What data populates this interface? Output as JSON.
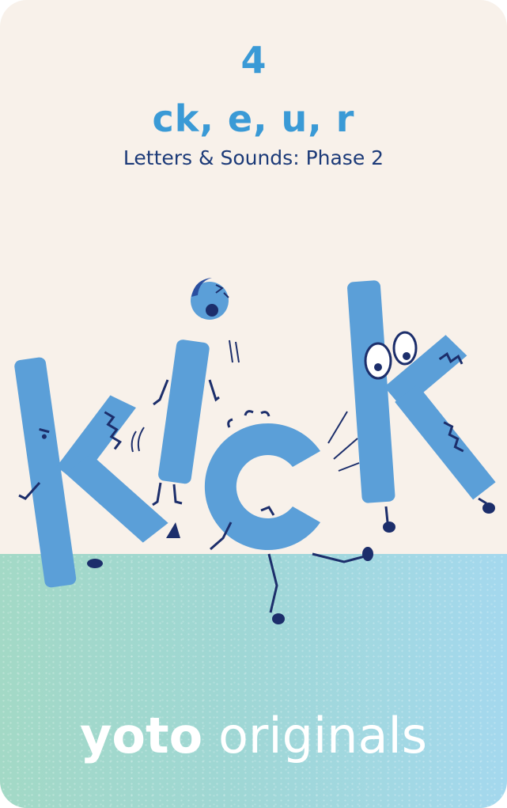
{
  "card": {
    "number": "4",
    "letters": "ck, e, u, r",
    "subtitle": "Letters & Sounds: Phase 2"
  },
  "illustration": {
    "word": "kick",
    "letter_color": "#5b9fd8"
  },
  "brand": {
    "name_bold": "yoto",
    "name_light": "originals"
  },
  "colors": {
    "background": "#f8f1ea",
    "accent": "#3a9ad6",
    "subtitle": "#1c3a78",
    "ground_left": "#a3d9c6",
    "ground_right": "#a4d8ee",
    "outline": "#1c2e6b"
  }
}
